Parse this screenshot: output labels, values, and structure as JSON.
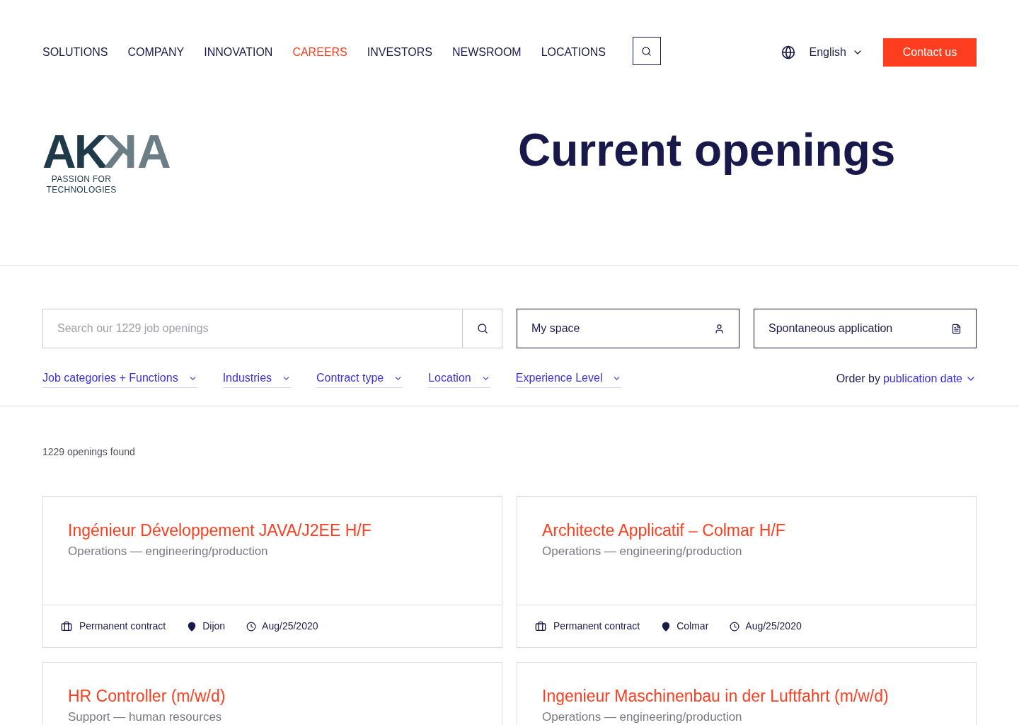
{
  "nav": {
    "items": [
      {
        "label": "SOLUTIONS",
        "selected": false
      },
      {
        "label": "COMPANY",
        "selected": false
      },
      {
        "label": "INNOVATION",
        "selected": false
      },
      {
        "label": "CAREERS",
        "selected": true
      },
      {
        "label": "INVESTORS",
        "selected": false
      },
      {
        "label": "NEWSROOM",
        "selected": false
      },
      {
        "label": "LOCATIONS",
        "selected": false
      }
    ],
    "language": "English",
    "contact": "Contact us"
  },
  "logo": {
    "wordmark": "AKKA",
    "tagline": "PASSION FOR TECHNOLOGIES"
  },
  "hero": {
    "title": "Current openings"
  },
  "search": {
    "placeholder": "Search our 1229 job openings",
    "my_space": "My space",
    "spontaneous": "Spontaneous application"
  },
  "filters": [
    "Job categories + Functions",
    "Industries",
    "Contract type",
    "Location",
    "Experience Level"
  ],
  "order": {
    "label": "Order by",
    "value": "publication date"
  },
  "results": {
    "count": "1229 openings found"
  },
  "jobs": [
    {
      "title": "Ingénieur Développement JAVA/J2EE H/F",
      "category": "Operations — engineering/production",
      "contract": "Permanent contract",
      "location": "Dijon",
      "date": "Aug/25/2020"
    },
    {
      "title": "Architecte Applicatif – Colmar H/F",
      "category": "Operations — engineering/production",
      "contract": "Permanent contract",
      "location": "Colmar",
      "date": "Aug/25/2020"
    },
    {
      "title": "HR Controller (m/w/d)",
      "category": "Support — human resources"
    },
    {
      "title": "Ingenieur Maschinenbau in der Luftfahrt (m/w/d)",
      "category": "Operations — engineering/production"
    }
  ]
}
